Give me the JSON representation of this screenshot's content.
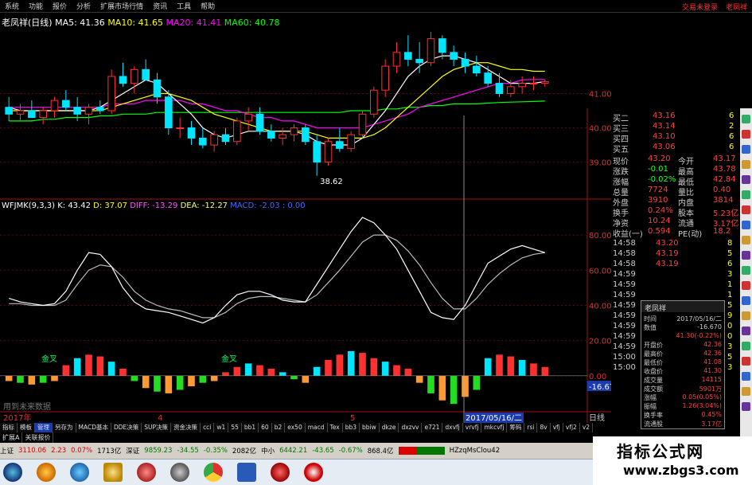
{
  "menu": {
    "items": [
      "系统",
      "功能",
      "报价",
      "分析",
      "扩展市场行情",
      "资讯",
      "工具",
      "帮助"
    ],
    "right": [
      "交易未登录",
      "老凤祥"
    ]
  },
  "ma_line": {
    "name": "老凤祥(日线)",
    "ma5": "MA5: 41.36",
    "ma10": "MA10: 41.65",
    "ma20": "MA20: 41.41",
    "ma60": "MA60: 40.78"
  },
  "indicator_line": {
    "name": "WFJMK(9,3,3)",
    "k": "K: 43.42",
    "d": "D: 37.07",
    "diff": "DIFF: -13.29",
    "dea": "DEA: -12.27",
    "macd": "MACD: -2.03",
    "tail": ": 0.00"
  },
  "price_axis": [
    "41.00",
    "40.00",
    "39.00"
  ],
  "ind_axis": [
    "80.00",
    "60.00",
    "40.00",
    "20.00",
    "0.00"
  ],
  "low_label": "38.62",
  "neg_label": "-16.67",
  "annotations": {
    "cross_left": "金叉",
    "cross_right": "金叉",
    "no_data": "用到未来数据"
  },
  "time_axis": {
    "year": "2017年",
    "m4": "4",
    "m5": "5",
    "cursor_date": "2017/05/16/二",
    "period": "日线"
  },
  "order_book": [
    {
      "label": "买二",
      "price": "43.16",
      "vol": "6"
    },
    {
      "label": "买三",
      "price": "43.14",
      "vol": "2"
    },
    {
      "label": "买四",
      "price": "43.10",
      "vol": "6"
    },
    {
      "label": "买五",
      "price": "43.06",
      "vol": "6"
    }
  ],
  "quote": [
    {
      "l1": "现价",
      "v1": "43.20",
      "l2": "今开",
      "v2": "43.17"
    },
    {
      "l1": "涨跌",
      "v1": "-0.01",
      "l2": "最高",
      "v2": "43.78"
    },
    {
      "l1": "涨幅",
      "v1": "-0.02%",
      "l2": "最低",
      "v2": "42.84"
    },
    {
      "l1": "总量",
      "v1": "7724",
      "l2": "量比",
      "v2": "0.40"
    },
    {
      "l1": "外盘",
      "v1": "3910",
      "l2": "内盘",
      "v2": "3814"
    },
    {
      "l1": "换手",
      "v1": "0.24%",
      "l2": "股本",
      "v2": "5.23亿"
    },
    {
      "l1": "净资",
      "v1": "10.24",
      "l2": "流通",
      "v2": "3.17亿"
    },
    {
      "l1": "收益(一)",
      "v1": "0.594",
      "l2": "PE(动)",
      "v2": "18.2"
    }
  ],
  "ticks": [
    {
      "t": "14:58",
      "p": "43.20",
      "v": "8"
    },
    {
      "t": "14:58",
      "p": "43.19",
      "v": "5"
    },
    {
      "t": "14:58",
      "p": "43.19",
      "v": "6"
    },
    {
      "t": "14:59",
      "p": "",
      "v": "3"
    },
    {
      "t": "14:59",
      "p": "",
      "v": "1"
    },
    {
      "t": "14:59",
      "p": "",
      "v": "1"
    },
    {
      "t": "14:59",
      "p": "",
      "v": "5"
    },
    {
      "t": "14:59",
      "p": "",
      "v": "9"
    },
    {
      "t": "14:59",
      "p": "",
      "v": "0"
    },
    {
      "t": "14:59",
      "p": "",
      "v": "0"
    },
    {
      "t": "14:59",
      "p": "",
      "v": "3"
    },
    {
      "t": "15:00",
      "p": "",
      "v": "5"
    },
    {
      "t": "15:00",
      "p": "",
      "v": "3"
    }
  ],
  "popup": {
    "title": "老凤祥",
    "rows": [
      {
        "k": "时间",
        "v": "2017/05/16/二"
      },
      {
        "k": "数值",
        "v": "-16.670"
      },
      {
        "k": "",
        "v": "41.30(-0.22%)"
      },
      {
        "k": "开盘价",
        "v": "42.36"
      },
      {
        "k": "最高价",
        "v": "42.36"
      },
      {
        "k": "最低价",
        "v": "41.08"
      },
      {
        "k": "收盘价",
        "v": "41.30"
      },
      {
        "k": "成交量",
        "v": "14115"
      },
      {
        "k": "成交额",
        "v": "5901万"
      },
      {
        "k": "涨幅",
        "v": "0.05(0.05%)"
      },
      {
        "k": "振幅",
        "v": "1.26(3.04%)"
      },
      {
        "k": "换手率",
        "v": "0.45%"
      },
      {
        "k": "流通股",
        "v": "3.17亿"
      }
    ]
  },
  "tabs1": [
    "指标",
    "模板",
    "管理",
    "另存为",
    "MACD基本",
    "DDE决策",
    "SUP决策",
    "资金决策",
    "cci",
    "w1",
    "55",
    "bb1",
    "60",
    "b2",
    "ex50",
    "macd",
    "Tex",
    "bb3",
    "bbiw",
    "dkze",
    "dxzvv",
    "e721",
    "dxvfj",
    "vrvfj",
    "mkcvfj",
    "筹码",
    "rsi",
    "8v",
    "vfj",
    "vfj2",
    "v2"
  ],
  "tabs2": [
    "扩展A",
    "关联报价"
  ],
  "status": {
    "sh_label": "上证",
    "sh_value": "3110.06",
    "sh_change": "2.23",
    "sh_pct": "0.07%",
    "sh_amount": "1713亿",
    "sz_label": "深证",
    "sz_value": "9859.23",
    "sz_change": "-34.55",
    "sz_pct": "-0.35%",
    "sz_amount": "2082亿",
    "zx_label": "中小",
    "zx_value": "6442.21",
    "zx_change": "-43.65",
    "zx_pct": "-0.67%",
    "zx_amount": "868.4亿",
    "tail": "HZzqMsClou42"
  },
  "watermark": {
    "title": "指标公式网",
    "url": "www.zbgs3.com"
  },
  "colors": {
    "up": "#ff3030",
    "down": "#00e5ff",
    "ma5": "#ffffff",
    "ma10": "#ffff00",
    "ma20": "#ff00ff",
    "ma60": "#00ff00",
    "diff": "#ff55ff",
    "dea": "#ffff66",
    "macd": "#4466ff"
  },
  "chart_data": {
    "type": "candlestick",
    "price_ylim": [
      38.2,
      42.8
    ],
    "candles": [
      [
        40.6,
        40.9,
        40.2,
        40.4
      ],
      [
        40.4,
        40.7,
        40.2,
        40.5
      ],
      [
        40.5,
        40.8,
        40.3,
        40.3
      ],
      [
        40.3,
        40.6,
        40.1,
        40.5
      ],
      [
        40.5,
        40.9,
        40.3,
        40.8
      ],
      [
        40.8,
        41.1,
        40.5,
        40.6
      ],
      [
        40.6,
        40.9,
        40.2,
        40.4
      ],
      [
        40.4,
        40.7,
        40.1,
        40.6
      ],
      [
        40.6,
        40.8,
        40.4,
        40.5
      ],
      [
        40.5,
        41.7,
        40.4,
        41.5
      ],
      [
        41.5,
        41.9,
        41.2,
        41.3
      ],
      [
        41.3,
        41.8,
        41.0,
        41.7
      ],
      [
        41.7,
        42.0,
        41.4,
        41.4
      ],
      [
        41.4,
        41.6,
        40.7,
        40.9
      ],
      [
        40.9,
        41.1,
        39.8,
        40.0
      ],
      [
        40.0,
        40.3,
        39.7,
        40.0
      ],
      [
        40.0,
        40.2,
        39.5,
        39.7
      ],
      [
        39.7,
        40.0,
        39.4,
        39.5
      ],
      [
        39.5,
        39.9,
        39.3,
        39.8
      ],
      [
        39.8,
        40.0,
        39.5,
        39.6
      ],
      [
        39.6,
        40.3,
        39.5,
        40.2
      ],
      [
        40.2,
        40.6,
        39.9,
        40.4
      ],
      [
        40.4,
        40.6,
        39.8,
        39.9
      ],
      [
        39.9,
        40.1,
        39.6,
        39.7
      ],
      [
        39.7,
        40.0,
        39.5,
        39.8
      ],
      [
        39.8,
        40.1,
        39.6,
        40.0
      ],
      [
        40.0,
        40.1,
        39.5,
        39.6
      ],
      [
        39.6,
        39.8,
        38.6,
        39.0
      ],
      [
        39.0,
        39.7,
        38.9,
        39.6
      ],
      [
        39.6,
        40.0,
        39.3,
        39.4
      ],
      [
        39.4,
        39.9,
        39.3,
        39.8
      ],
      [
        39.8,
        40.5,
        39.7,
        40.4
      ],
      [
        40.4,
        41.2,
        40.3,
        41.1
      ],
      [
        41.1,
        42.0,
        40.9,
        41.8
      ],
      [
        41.8,
        42.5,
        41.6,
        42.2
      ],
      [
        42.2,
        42.7,
        41.8,
        42.0
      ],
      [
        42.0,
        42.5,
        41.6,
        41.9
      ],
      [
        41.9,
        42.8,
        41.8,
        42.6
      ],
      [
        42.6,
        42.7,
        42.0,
        42.2
      ],
      [
        42.2,
        42.4,
        41.8,
        42.0
      ],
      [
        42.0,
        42.2,
        41.6,
        41.8
      ],
      [
        41.8,
        42.1,
        41.5,
        41.6
      ],
      [
        41.6,
        41.8,
        41.2,
        41.3
      ],
      [
        41.3,
        41.6,
        40.9,
        41.0
      ],
      [
        41.0,
        41.4,
        40.9,
        41.2
      ],
      [
        41.2,
        41.5,
        41.0,
        41.3
      ],
      [
        41.3,
        41.5,
        41.1,
        41.3
      ],
      [
        41.3,
        41.4,
        41.2,
        41.35
      ]
    ],
    "ma5": [
      40.6,
      40.5,
      40.5,
      40.5,
      40.5,
      40.5,
      40.5,
      40.5,
      40.6,
      40.8,
      41.0,
      41.2,
      41.4,
      41.3,
      41.0,
      40.7,
      40.4,
      40.0,
      39.8,
      39.7,
      39.8,
      39.9,
      39.9,
      39.9,
      39.9,
      39.9,
      39.8,
      39.6,
      39.5,
      39.5,
      39.5,
      39.7,
      40.1,
      40.5,
      41.0,
      41.5,
      41.8,
      42.0,
      42.1,
      42.1,
      42.0,
      41.9,
      41.7,
      41.5,
      41.3,
      41.3,
      41.3,
      41.35
    ],
    "ma10": [
      40.5,
      40.5,
      40.5,
      40.5,
      40.5,
      40.5,
      40.5,
      40.5,
      40.5,
      40.6,
      40.7,
      40.8,
      40.9,
      41.0,
      41.0,
      40.9,
      40.8,
      40.6,
      40.4,
      40.3,
      40.2,
      40.1,
      40.0,
      39.9,
      39.9,
      39.9,
      39.9,
      39.8,
      39.7,
      39.7,
      39.7,
      39.7,
      39.8,
      40.0,
      40.3,
      40.6,
      40.9,
      41.2,
      41.5,
      41.7,
      41.8,
      41.9,
      41.9,
      41.8,
      41.7,
      41.7,
      41.65,
      41.65
    ],
    "ma20": [
      40.6,
      40.6,
      40.6,
      40.6,
      40.6,
      40.6,
      40.6,
      40.6,
      40.6,
      40.7,
      40.7,
      40.7,
      40.8,
      40.8,
      40.8,
      40.8,
      40.7,
      40.7,
      40.6,
      40.5,
      40.5,
      40.4,
      40.3,
      40.3,
      40.2,
      40.2,
      40.1,
      40.0,
      40.0,
      40.0,
      40.0,
      40.0,
      40.1,
      40.2,
      40.3,
      40.4,
      40.6,
      40.7,
      40.8,
      40.9,
      41.0,
      41.1,
      41.2,
      41.3,
      41.3,
      41.4,
      41.41,
      41.41
    ],
    "ma60": [
      40.2,
      40.2,
      40.2,
      40.25,
      40.25,
      40.3,
      40.3,
      40.3,
      40.35,
      40.35,
      40.4,
      40.4,
      40.4,
      40.45,
      40.45,
      40.45,
      40.45,
      40.45,
      40.45,
      40.45,
      40.45,
      40.45,
      40.45,
      40.45,
      40.45,
      40.45,
      40.45,
      40.45,
      40.45,
      40.45,
      40.5,
      40.5,
      40.5,
      40.55,
      40.55,
      40.6,
      40.6,
      40.65,
      40.65,
      40.7,
      40.7,
      40.7,
      40.72,
      40.74,
      40.75,
      40.76,
      40.77,
      40.78
    ],
    "ind_ylim": [
      -20,
      95
    ],
    "k": [
      44,
      42,
      41,
      40,
      41,
      48,
      60,
      70,
      69,
      62,
      50,
      42,
      38,
      37,
      36,
      34,
      32,
      30,
      33,
      40,
      46,
      48,
      48,
      46,
      43,
      42,
      42,
      52,
      62,
      72,
      82,
      90,
      87,
      80,
      72,
      60,
      48,
      36,
      33,
      32,
      40,
      52,
      64,
      68,
      72,
      74,
      72,
      70
    ],
    "d": [
      41,
      41,
      40,
      40,
      40,
      43,
      52,
      60,
      63,
      62,
      56,
      48,
      43,
      40,
      38,
      37,
      35,
      33,
      33,
      36,
      41,
      44,
      45,
      45,
      44,
      43,
      42,
      46,
      53,
      60,
      68,
      76,
      80,
      80,
      77,
      71,
      63,
      53,
      44,
      38,
      38,
      44,
      52,
      58,
      63,
      67,
      69,
      70
    ],
    "macd_bars": [
      -3,
      -4,
      -5,
      -4,
      -3,
      6,
      10,
      12,
      11,
      8,
      4,
      -3,
      -7,
      -9,
      -10,
      -8,
      -6,
      -4,
      -3,
      2,
      5,
      7,
      6,
      4,
      2,
      -2,
      -4,
      5,
      9,
      12,
      14,
      13,
      10,
      8,
      6,
      4,
      -4,
      -10,
      -14,
      -16,
      -12,
      -8,
      10,
      12,
      11,
      9,
      7,
      5
    ],
    "x_labels": [
      "2017年",
      "4",
      "5",
      "2017/05/16/二"
    ]
  }
}
